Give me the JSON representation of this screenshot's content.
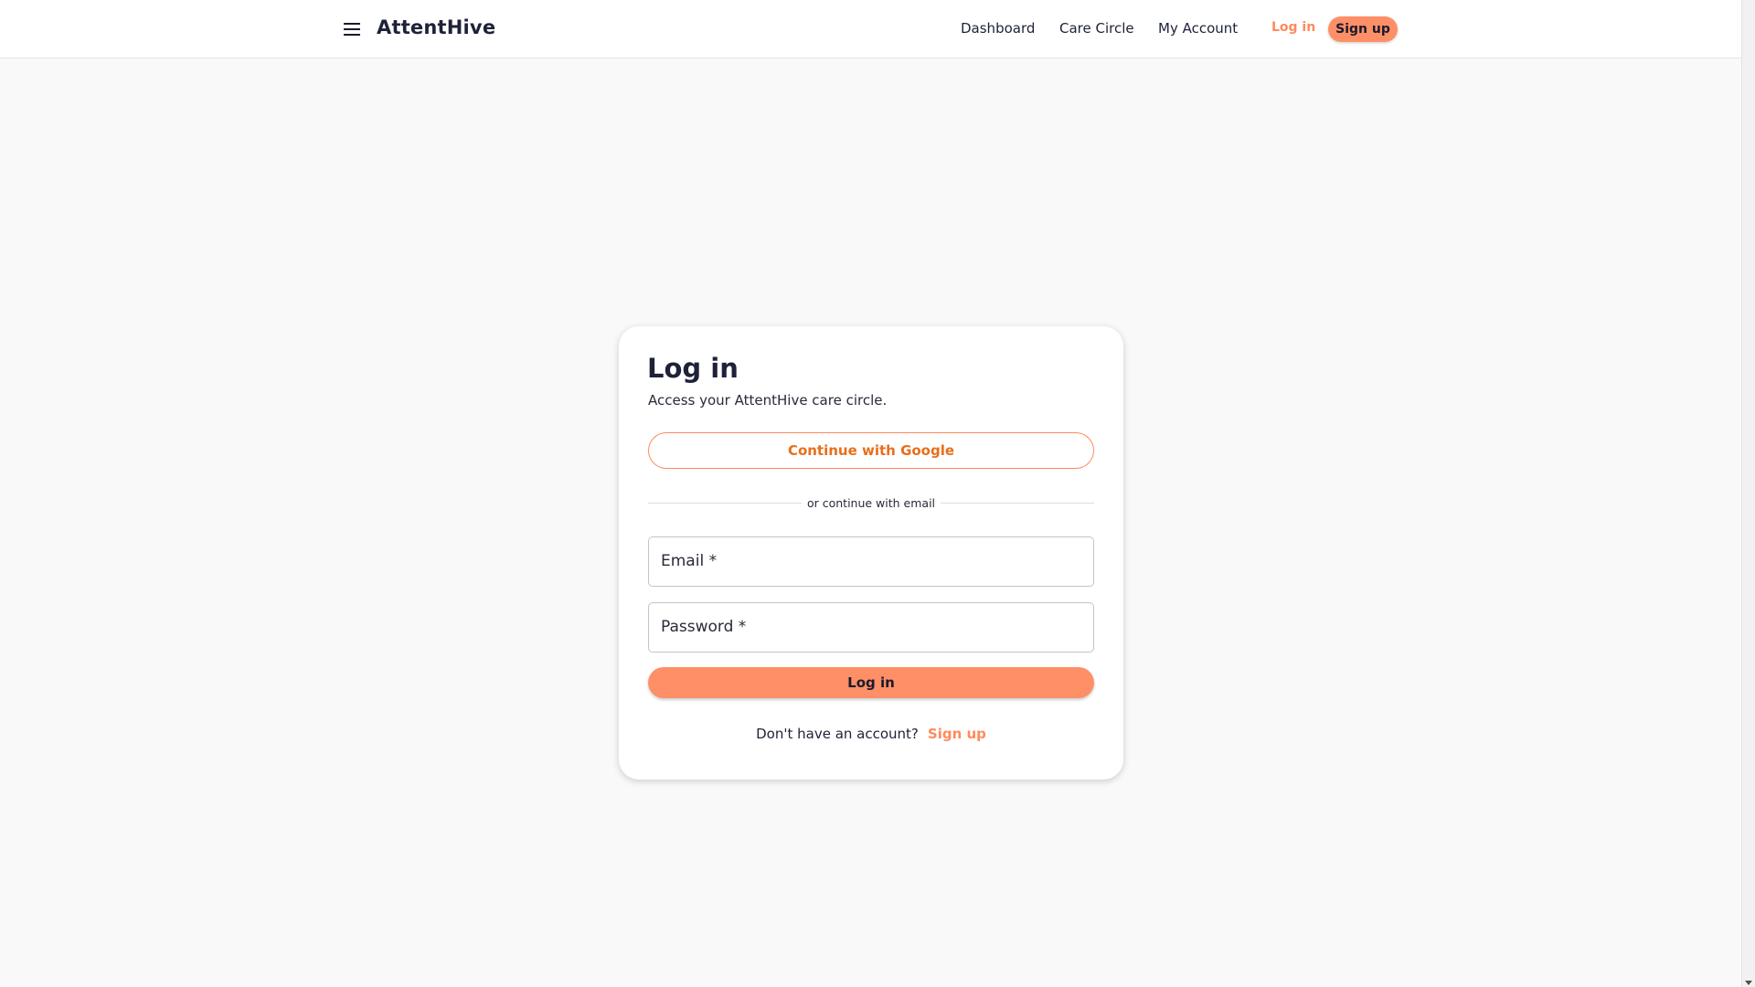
{
  "header": {
    "brand": "AttentHive",
    "nav": [
      "Dashboard",
      "Care Circle",
      "My Account"
    ],
    "login_label": "Log in",
    "signup_label": "Sign up"
  },
  "login_card": {
    "title": "Log in",
    "subtitle": "Access your AttentHive care circle.",
    "google_button": "Continue with Google",
    "divider": "or continue with email",
    "email_label": "Email *",
    "password_label": "Password *",
    "submit_label": "Log in",
    "no_account_text": "Don't have an account?",
    "signup_link": "Sign up"
  },
  "colors": {
    "accent": "#ff8f66",
    "accent_text": "#ff8a5b",
    "google_text": "#e86f1c",
    "heading": "#1e2238",
    "background": "#f9f9f9"
  },
  "icons": {
    "menu": "hamburger-menu-icon",
    "scroll_down": "scroll-down-arrow-icon"
  }
}
